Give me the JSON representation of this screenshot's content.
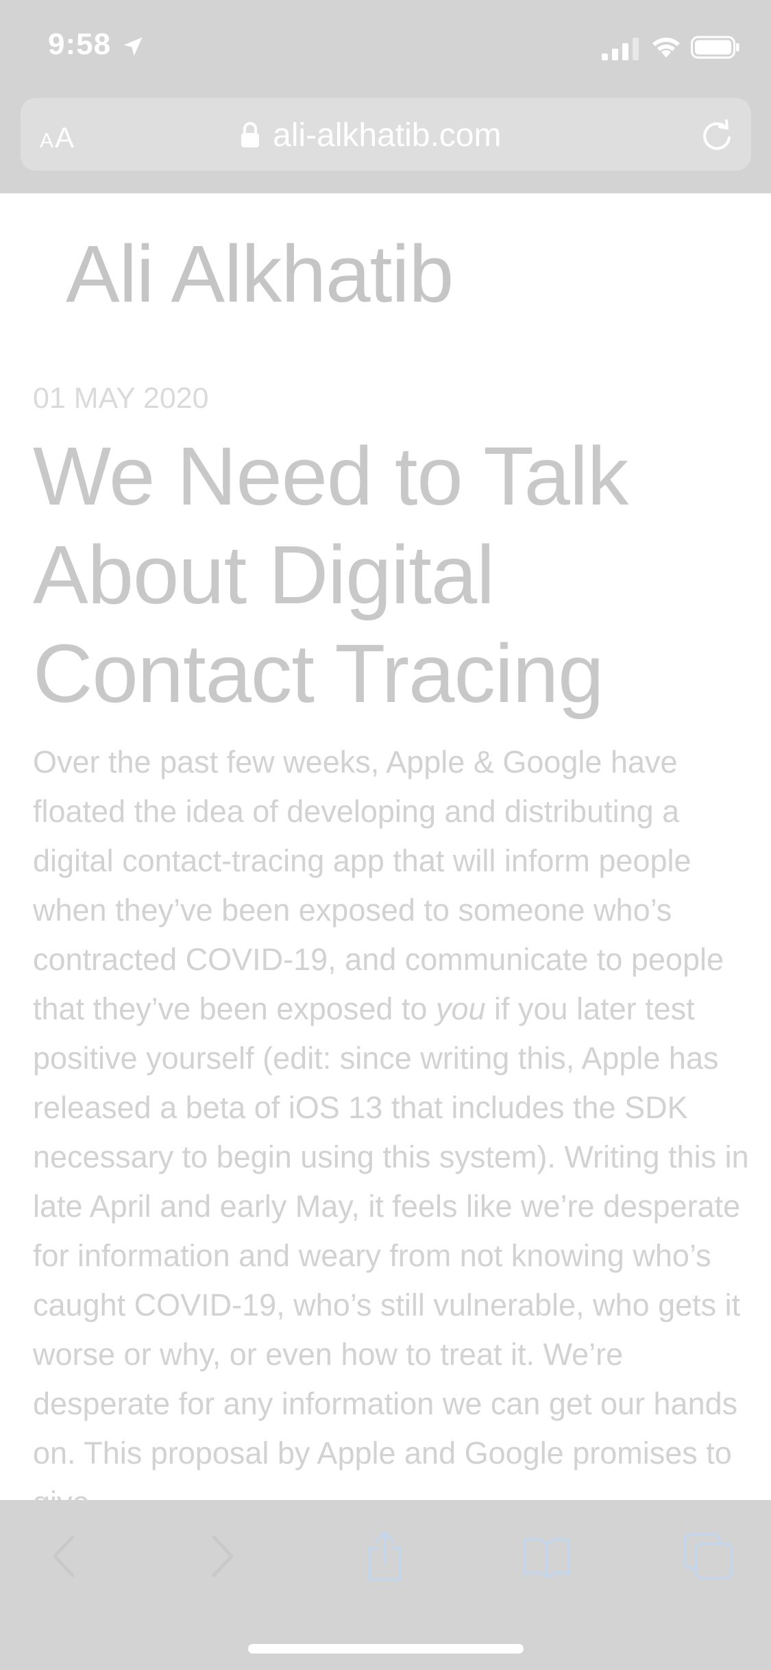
{
  "status_bar": {
    "time": "9:58",
    "icons": [
      "location-arrow-icon",
      "cellular-signal-icon",
      "wifi-icon",
      "battery-icon"
    ]
  },
  "address_bar": {
    "aa_small": "A",
    "aa_large": "A",
    "url": "ali-alkhatib.com",
    "icons": [
      "lock-icon",
      "reload-icon"
    ]
  },
  "page": {
    "site_title": "Ali Alkhatib",
    "date": "01 MAY 2020",
    "post_title": "We Need to Talk About Digital Contact Tracing",
    "body_before_emphasis": "Over the past few weeks, Apple & Google have floated the idea of developing and distributing a digital contact-tracing app that will inform people when they’ve been exposed to someone who’s contracted COVID-19, and communicate to people that they’ve been exposed to ",
    "body_emphasis": "you",
    "body_after_emphasis": " if you later test positive yourself (edit: since writing this, Apple has released a beta of iOS 13 that includes the SDK necessary to begin using this system). Writing this in late April and early May, it feels like we’re desperate for information and weary from not knowing who’s caught COVID-19, who’s still vulnerable, who gets it worse or why, or even how to treat it. We’re desperate for any information we can get our hands on. This proposal by Apple and Google promises to give"
  },
  "toolbar": {
    "icons": [
      "back-icon",
      "forward-icon",
      "share-icon",
      "bookmarks-icon",
      "tabs-icon"
    ]
  },
  "colors": {
    "chrome": "#d3d3d3",
    "icon_tint": "#c5d6ea",
    "text_faded": "#c8c8c8"
  }
}
